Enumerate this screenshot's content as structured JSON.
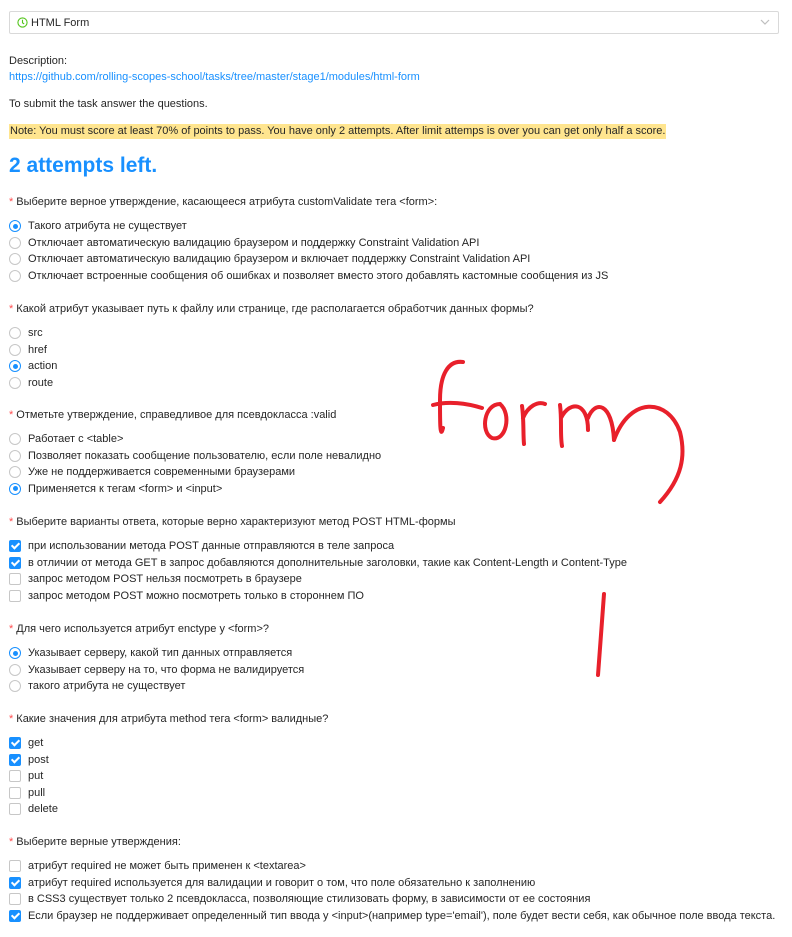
{
  "header": {
    "select_value": "HTML Form"
  },
  "description": {
    "label": "Description:",
    "link": "https://github.com/rolling-scopes-school/tasks/tree/master/stage1/modules/html-form"
  },
  "submit_note": "To submit the task answer the questions.",
  "warning": "Note: You must score at least 70% of points to pass. You have only 2 attempts. After limit attemps is over you can get only half a score.",
  "attempts_left": "2 attempts left.",
  "questions": [
    {
      "title": "Выберите верное утверждение, касающееся атрибута customValidate тега <form>:",
      "type": "radio",
      "options": [
        {
          "label": "Такого атрибута не существует",
          "checked": true
        },
        {
          "label": "Отключает автоматическую валидацию браузером и поддержку Constraint Validation API",
          "checked": false
        },
        {
          "label": "Отключает автоматическую валидацию браузером и включает поддержку Constraint Validation API",
          "checked": false
        },
        {
          "label": "Отключает встроенные сообщения об ошибках и позволяет вместо этого добавлять кастомные сообщения из JS",
          "checked": false
        }
      ]
    },
    {
      "title": "Какой атрибут указывает путь к файлу или странице, где располагается обработчик данных формы?",
      "type": "radio",
      "options": [
        {
          "label": "src",
          "checked": false
        },
        {
          "label": "href",
          "checked": false
        },
        {
          "label": "action",
          "checked": true
        },
        {
          "label": "route",
          "checked": false
        }
      ]
    },
    {
      "title": "Отметьте утверждение, справедливое для псевдокласса :valid",
      "type": "radio",
      "options": [
        {
          "label": "Работает с <table>",
          "checked": false
        },
        {
          "label": "Позволяет показать сообщение пользователю, если поле невалидно",
          "checked": false
        },
        {
          "label": "Уже не поддерживается современными браузерами",
          "checked": false
        },
        {
          "label": "Применяется к тегам <form> и <input>",
          "checked": true
        }
      ]
    },
    {
      "title": "Выберите варианты ответа, которые верно характеризуют метод POST HTML-формы",
      "type": "checkbox",
      "options": [
        {
          "label": "при использовании метода POST данные отправляются в теле запроса",
          "checked": true
        },
        {
          "label": "в отличии от метода GET в запрос добавляются дополнительные заголовки, такие как Content-Length и Content-Type",
          "checked": true
        },
        {
          "label": "запрос методом POST нельзя посмотреть в браузере",
          "checked": false
        },
        {
          "label": "запрос методом POST можно посмотреть только в стороннем ПО",
          "checked": false
        }
      ]
    },
    {
      "title": "Для чего используется атрибут enctype у <form>?",
      "type": "radio",
      "options": [
        {
          "label": "Указывает серверу, какой тип данных отправляется",
          "checked": true
        },
        {
          "label": "Указывает серверу на то, что форма не валидируется",
          "checked": false
        },
        {
          "label": "такого атрибута не существует",
          "checked": false
        }
      ]
    },
    {
      "title": "Какие значения для атрибута method тега <form> валидные?",
      "type": "checkbox",
      "options": [
        {
          "label": "get",
          "checked": true
        },
        {
          "label": "post",
          "checked": true
        },
        {
          "label": "put",
          "checked": false
        },
        {
          "label": "pull",
          "checked": false
        },
        {
          "label": "delete",
          "checked": false
        }
      ]
    },
    {
      "title": "Выберите верные утверждения:",
      "type": "checkbox",
      "options": [
        {
          "label": "атрибут required не может быть применен к <textarea>",
          "checked": false
        },
        {
          "label": "атрибут required используется для валидации и говорит о том, что поле обязательно к заполнению",
          "checked": true
        },
        {
          "label": "в CSS3 существует только 2 псевдокласса, позволяющие стилизовать форму, в зависимости от ее состояния",
          "checked": false
        },
        {
          "label": "Если браузер не поддерживает определенный тип ввода у <input>(например type='email'), поле будет вести себя, как обычное поле ввода текста.",
          "checked": true
        }
      ]
    }
  ],
  "icons": {
    "select": "clock-circle-icon",
    "select_arrow": "chevron-down-icon"
  },
  "colors": {
    "accent": "#1890ff",
    "warning_bg": "#ffe58f",
    "required": "#ff4d4f",
    "scribble": "#e8202b"
  }
}
